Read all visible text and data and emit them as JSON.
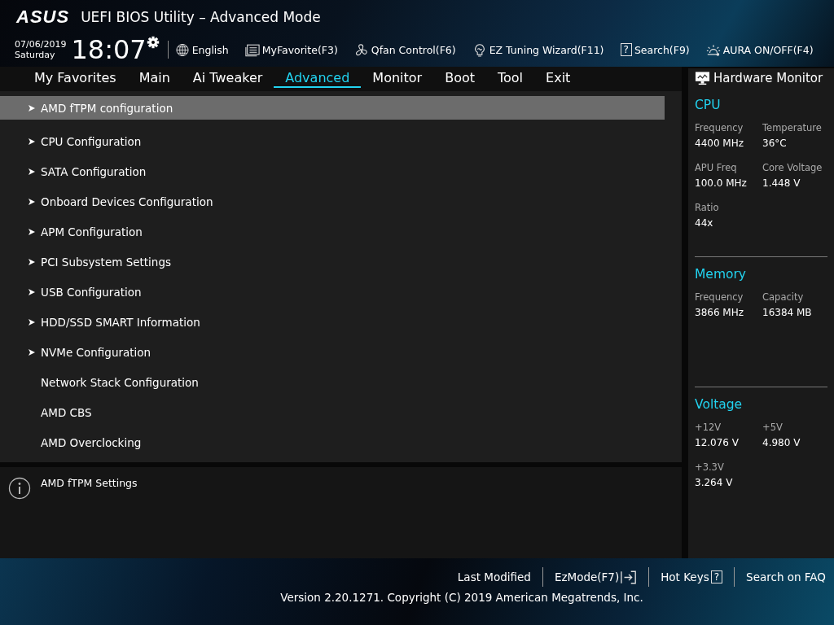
{
  "header": {
    "logo": "ASUS",
    "title": "UEFI BIOS Utility – Advanced Mode",
    "date": "07/06/2019",
    "weekday": "Saturday",
    "time": "18:07",
    "tools": [
      {
        "kind": "language",
        "label": "English"
      },
      {
        "kind": "favorite",
        "label": "MyFavorite(F3)"
      },
      {
        "kind": "fan",
        "label": "Qfan Control(F6)"
      },
      {
        "kind": "wizard",
        "label": "EZ Tuning Wizard(F11)"
      },
      {
        "kind": "search",
        "label": "Search(F9)",
        "key_icon": "?"
      },
      {
        "kind": "aura",
        "label": "AURA ON/OFF(F4)"
      }
    ]
  },
  "tabs": [
    {
      "label": "My Favorites",
      "selected": false
    },
    {
      "label": "Main",
      "selected": false
    },
    {
      "label": "Ai Tweaker",
      "selected": false
    },
    {
      "label": "Advanced",
      "selected": true
    },
    {
      "label": "Monitor",
      "selected": false
    },
    {
      "label": "Boot",
      "selected": false
    },
    {
      "label": "Tool",
      "selected": false
    },
    {
      "label": "Exit",
      "selected": false
    }
  ],
  "menu": [
    {
      "kind": "submenu",
      "label": "AMD fTPM configuration",
      "selected": true
    },
    {
      "kind": "submenu",
      "label": "CPU Configuration",
      "selected": false
    },
    {
      "kind": "submenu",
      "label": "SATA Configuration",
      "selected": false
    },
    {
      "kind": "submenu",
      "label": "Onboard Devices Configuration",
      "selected": false
    },
    {
      "kind": "submenu",
      "label": "APM Configuration",
      "selected": false
    },
    {
      "kind": "submenu",
      "label": "PCI Subsystem Settings",
      "selected": false
    },
    {
      "kind": "submenu",
      "label": "USB Configuration",
      "selected": false
    },
    {
      "kind": "submenu",
      "label": "HDD/SSD SMART Information",
      "selected": false
    },
    {
      "kind": "submenu",
      "label": "NVMe Configuration",
      "selected": false
    },
    {
      "kind": "item",
      "label": "Network Stack Configuration",
      "selected": false
    },
    {
      "kind": "item",
      "label": "AMD CBS",
      "selected": false
    },
    {
      "kind": "item",
      "label": "AMD Overclocking",
      "selected": false
    }
  ],
  "help": "AMD fTPM Settings",
  "hardware_monitor": {
    "title": "Hardware Monitor",
    "sections": [
      {
        "name": "CPU",
        "readings": [
          {
            "label": "Frequency",
            "value": "4400 MHz"
          },
          {
            "label": "Temperature",
            "value": "36°C"
          },
          {
            "label": "APU Freq",
            "value": "100.0 MHz"
          },
          {
            "label": "Core Voltage",
            "value": "1.448 V"
          },
          {
            "label": "Ratio",
            "value": "44x"
          }
        ]
      },
      {
        "name": "Memory",
        "readings": [
          {
            "label": "Frequency",
            "value": "3866 MHz"
          },
          {
            "label": "Capacity",
            "value": "16384 MB"
          }
        ]
      },
      {
        "name": "Voltage",
        "readings": [
          {
            "label": "+12V",
            "value": "12.076 V"
          },
          {
            "label": "+5V",
            "value": "4.980 V"
          },
          {
            "label": "+3.3V",
            "value": "3.264 V"
          }
        ]
      }
    ]
  },
  "footer": {
    "buttons": [
      {
        "kind": "plain",
        "label": "Last Modified"
      },
      {
        "kind": "ezmode",
        "label": "EzMode(F7)"
      },
      {
        "kind": "hotkeys",
        "label": "Hot Keys",
        "key_icon": "?"
      },
      {
        "kind": "plain",
        "label": "Search on FAQ"
      }
    ],
    "version": "Version 2.20.1271. Copyright (C) 2019 American Megatrends, Inc."
  }
}
